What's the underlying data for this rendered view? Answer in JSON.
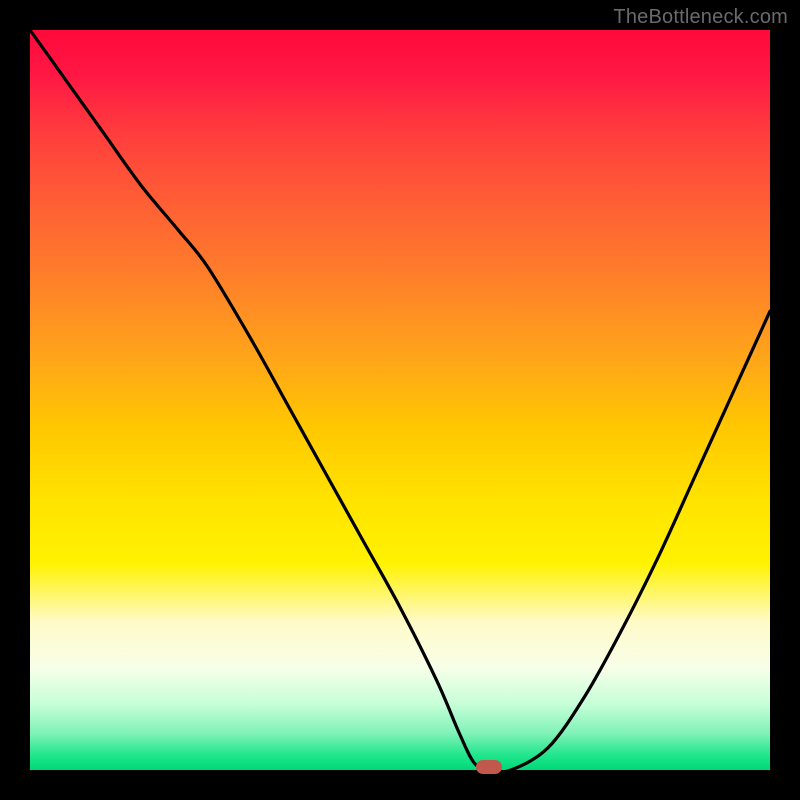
{
  "watermark": "TheBottleneck.com",
  "colors": {
    "frame": "#000000",
    "curve": "#000000",
    "marker_fill": "#c1584e",
    "gradient_stops": [
      "#ff0a3a",
      "#ff1744",
      "#ff3d3d",
      "#ff5a36",
      "#ff7a2c",
      "#ffa41a",
      "#ffc800",
      "#ffe400",
      "#fff200",
      "#fffac8",
      "#f8ffe8",
      "#c8ffd8",
      "#80f2b8",
      "#20e68c",
      "#00d878"
    ]
  },
  "chart_data": {
    "type": "line",
    "title": "",
    "xlabel": "",
    "ylabel": "",
    "xlim": [
      0,
      100
    ],
    "ylim": [
      0,
      100
    ],
    "grid": false,
    "legend": false,
    "series": [
      {
        "name": "bottleneck-curve",
        "x": [
          0,
          5,
          10,
          15,
          20,
          24,
          30,
          35,
          40,
          45,
          50,
          55,
          58,
          60,
          62,
          65,
          70,
          75,
          80,
          85,
          90,
          95,
          100
        ],
        "y": [
          100,
          93,
          86,
          79,
          73,
          68,
          58,
          49,
          40,
          31,
          22,
          12,
          5,
          1,
          0,
          0,
          3,
          10,
          19,
          29,
          40,
          51,
          62
        ]
      }
    ],
    "marker": {
      "x": 62,
      "y": 0,
      "label": ""
    }
  }
}
